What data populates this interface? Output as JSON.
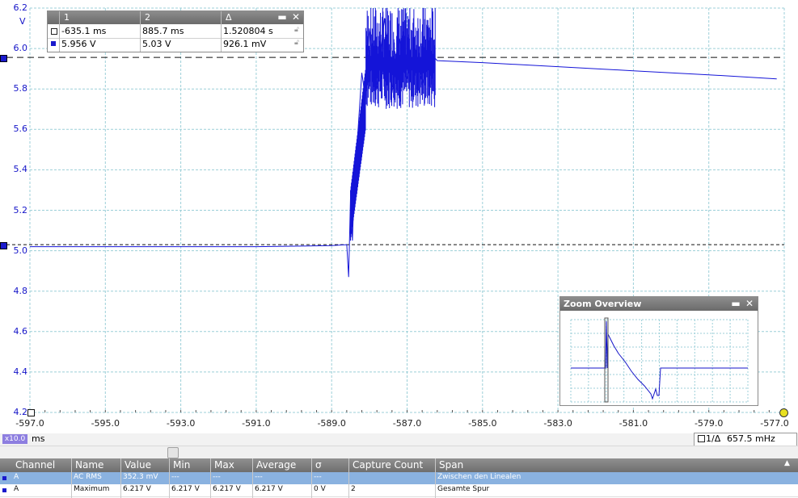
{
  "scope": {
    "y_unit": "V",
    "y_ticks": [
      "6.2",
      "6.0",
      "5.8",
      "5.6",
      "5.4",
      "5.2",
      "5.0",
      "4.8",
      "4.6",
      "4.4",
      "4.2"
    ],
    "x_ticks": [
      "-597.0",
      "-595.0",
      "-593.0",
      "-591.0",
      "-589.0",
      "-587.0",
      "-585.0",
      "-583.0",
      "-581.0",
      "-579.0",
      "-577.0"
    ],
    "trace_color": "#1414d8",
    "grid_color": "#9ccfd8"
  },
  "chart_data": {
    "type": "line",
    "xlabel": "ms",
    "ylabel": "V",
    "xlim": [
      -597.0,
      -577.0
    ],
    "ylim": [
      4.2,
      6.2
    ],
    "grid": true,
    "series": [
      {
        "x": [
          -597.0,
          -594.0,
          -591.0,
          -589.0,
          -588.6,
          -588.55,
          -588.5,
          -588.45,
          -588.4,
          -588.3,
          -588.2,
          -588.1,
          -588.0,
          -587.8,
          -587.6,
          -587.4,
          -587.2,
          -587.0,
          -586.8,
          -586.6,
          -586.4,
          -586.2,
          -585.0,
          -583.0,
          -581.0,
          -579.0,
          -577.2
        ],
        "y": [
          5.02,
          5.02,
          5.02,
          5.025,
          5.03,
          4.87,
          5.26,
          5.05,
          5.33,
          5.6,
          5.88,
          5.75,
          6.1,
          5.8,
          6.15,
          5.78,
          6.05,
          5.85,
          6.0,
          5.82,
          5.98,
          5.94,
          5.93,
          5.91,
          5.89,
          5.87,
          5.85
        ]
      }
    ],
    "cursors": {
      "horizontal_1": 5.956,
      "horizontal_2": 5.03
    }
  },
  "cursor_table": {
    "headers": [
      "1",
      "2",
      "Δ"
    ],
    "rows": [
      {
        "values": [
          "-635.1 ms",
          "885.7 ms",
          "1.520804 s"
        ]
      },
      {
        "values": [
          "5.956 V",
          "5.03 V",
          "926.1 mV"
        ]
      }
    ],
    "minimize_icon": "minimize-icon",
    "close_icon": "close-icon"
  },
  "zoom_overview": {
    "title": "Zoom Overview"
  },
  "timebar": {
    "zoom_badge": "x10.0",
    "unit": "ms",
    "freq_prefix": "1/Δ",
    "freq_value": "657.5 mHz"
  },
  "measurements": {
    "headers": [
      "Channel",
      "Name",
      "Value",
      "Min",
      "Max",
      "Average",
      "σ",
      "Capture Count",
      "Span"
    ],
    "rows": [
      [
        "A",
        "AC RMS",
        "352.3 mV",
        "---",
        "---",
        "---",
        "---",
        "",
        "Zwischen den Linealen"
      ],
      [
        "A",
        "Maximum",
        "6.217 V",
        "6.217 V",
        "6.217 V",
        "6.217 V",
        "0 V",
        "2",
        "Gesamte Spur"
      ]
    ]
  }
}
